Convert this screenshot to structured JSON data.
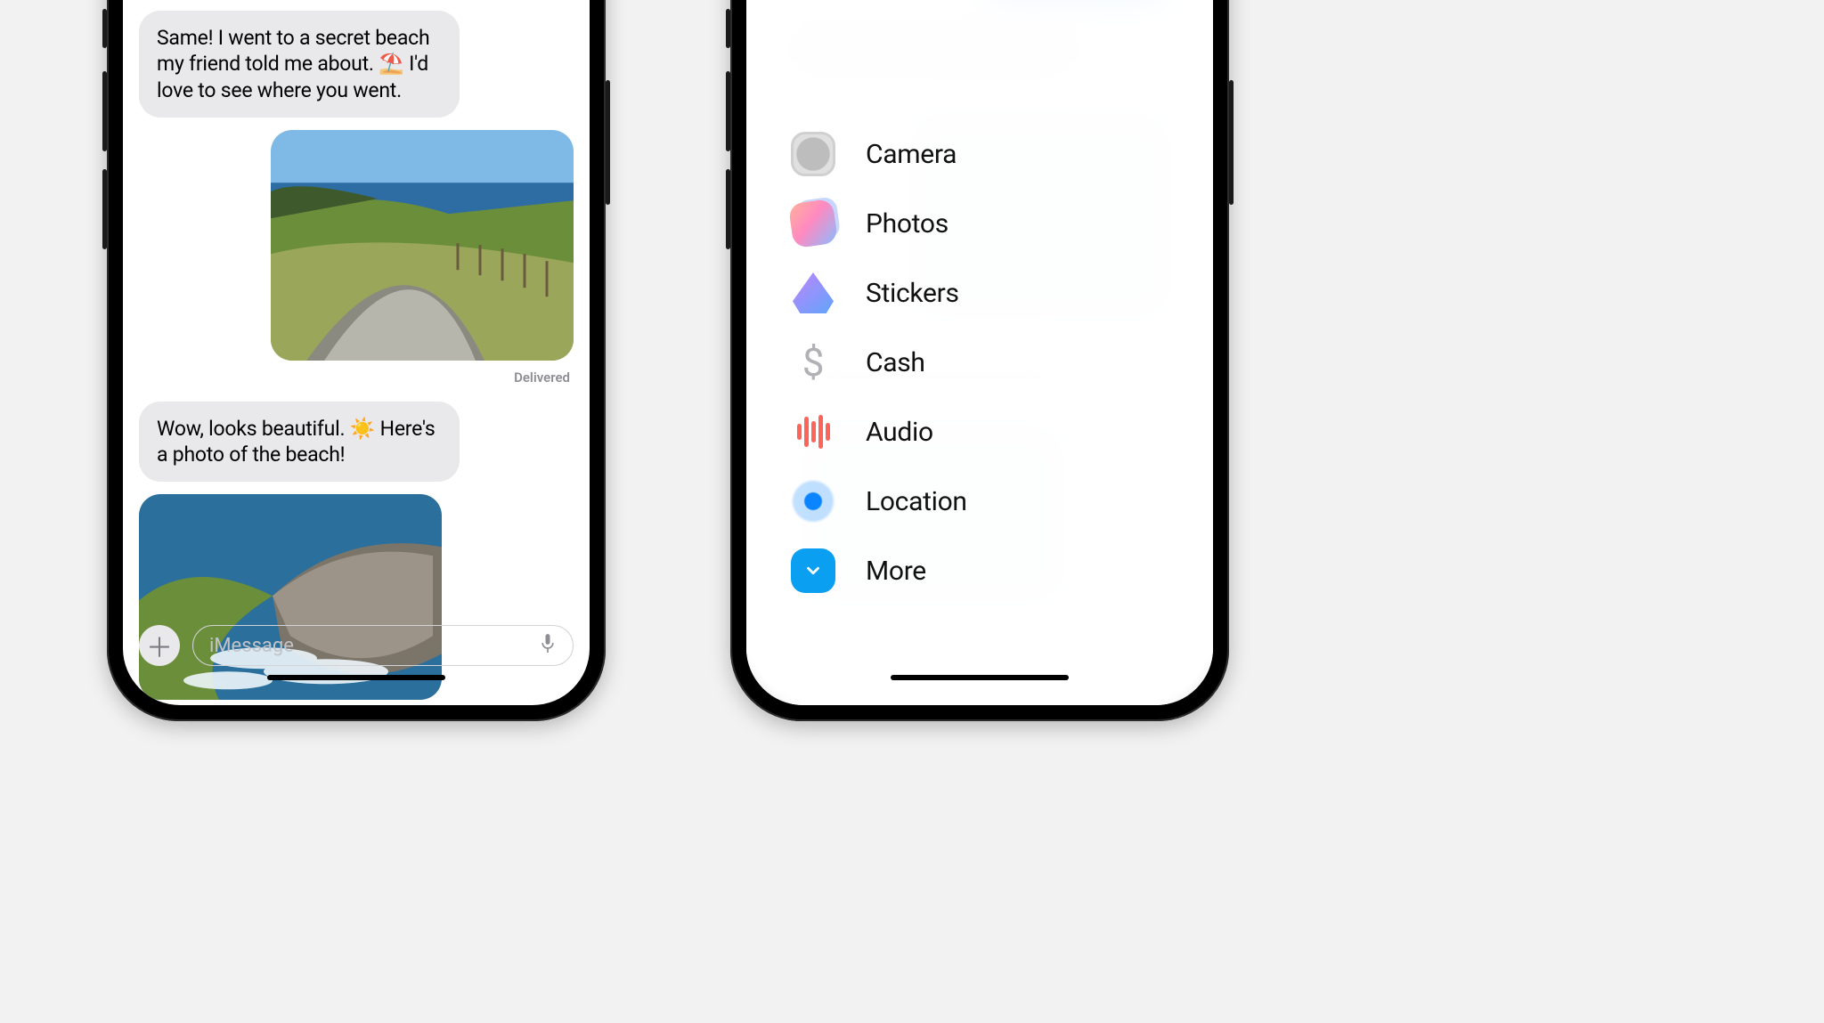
{
  "conversation": {
    "incoming1": "Same! I went to a secret beach my friend told me about. ⛱️ I'd love to see where you went.",
    "delivered_label": "Delivered",
    "incoming2": "Wow, looks beautiful. ☀️ Here's a photo of the beach!"
  },
  "compose": {
    "placeholder": "iMessage"
  },
  "attach_menu": {
    "items": [
      {
        "label": "Camera"
      },
      {
        "label": "Photos"
      },
      {
        "label": "Stickers"
      },
      {
        "label": "Cash"
      },
      {
        "label": "Audio"
      },
      {
        "label": "Location"
      },
      {
        "label": "More"
      }
    ]
  }
}
